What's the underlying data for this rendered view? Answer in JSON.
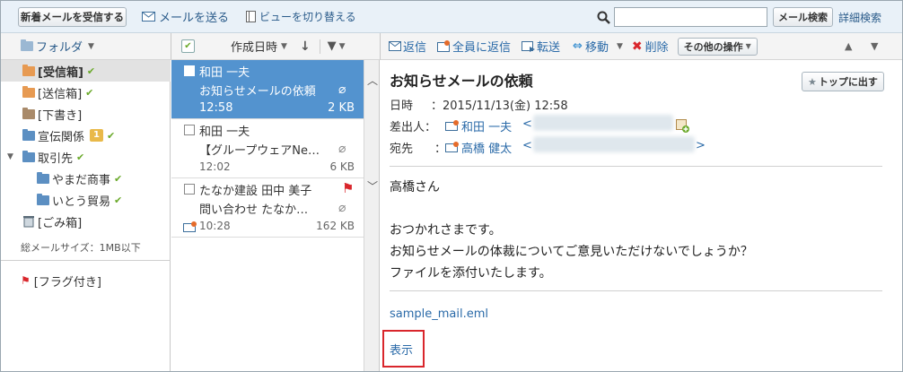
{
  "toolbar": {
    "receive_label": "新着メールを受信する",
    "send_label": "メールを送る",
    "view_label": "ビューを切り替える",
    "search_value": "",
    "search_button_label": "メール検索",
    "detail_search_label": "詳細検索"
  },
  "folders_header": {
    "label": "フォルダ"
  },
  "folders": [
    {
      "label": "[受信箱]",
      "selected": true,
      "check": true,
      "badge": ""
    },
    {
      "label": "[送信箱]",
      "selected": false,
      "check": true,
      "badge": ""
    },
    {
      "label": "[下書き]",
      "selected": false,
      "check": false,
      "badge": ""
    },
    {
      "label": "宣伝関係",
      "selected": false,
      "check": true,
      "badge": "1"
    },
    {
      "label": "取引先",
      "selected": false,
      "check": true,
      "badge": ""
    },
    {
      "label": "やまだ商事",
      "selected": false,
      "check": true,
      "badge": ""
    },
    {
      "label": "いとう貿易",
      "selected": false,
      "check": true,
      "badge": ""
    },
    {
      "label": "[ごみ箱]",
      "selected": false,
      "check": false,
      "badge": ""
    }
  ],
  "total_size": "総メールサイズ：1MB以下",
  "flagged_label": "[フラグ付き]",
  "list_header": {
    "sort_label": "作成日時"
  },
  "messages": [
    {
      "from": "和田 一夫",
      "subject": "お知らせメールの依頼",
      "time": "12:58",
      "size": "2 KB"
    },
    {
      "from": "和田 一夫",
      "subject": "【グループウェアNe…",
      "time": "12:02",
      "size": "6 KB"
    },
    {
      "from": "たなか建設 田中 美子",
      "subject": "問い合わせ たなか…",
      "time": "10:28",
      "size": "162 KB"
    }
  ],
  "actions": {
    "reply": "返信",
    "reply_all": "全員に返信",
    "forward": "転送",
    "move": "移動",
    "delete": "削除",
    "other": "その他の操作"
  },
  "mail": {
    "subject": "お知らせメールの依頼",
    "top_button": "トップに出す",
    "date_label": "日時",
    "date_value": "：2015/11/13(金) 12:58",
    "from_label": "差出人：",
    "from_name": "和田 一夫",
    "to_label": "宛先",
    "to_sep": "：",
    "to_name": "高橋 健太",
    "lt": "<",
    "gt": ">",
    "body": [
      "高橋さん",
      "",
      "おつかれさまです。",
      "お知らせメールの体裁についてご意見いただけないでしょうか？",
      "ファイルを添付いたします。"
    ],
    "attachment": "sample_mail.eml",
    "show_label": "表示"
  },
  "colors": {
    "selected_message": "#5393cf",
    "link": "#2a6aa8",
    "highlight_box": "#d9262c",
    "check": "#6aa92a",
    "badge": "#e9b949"
  }
}
